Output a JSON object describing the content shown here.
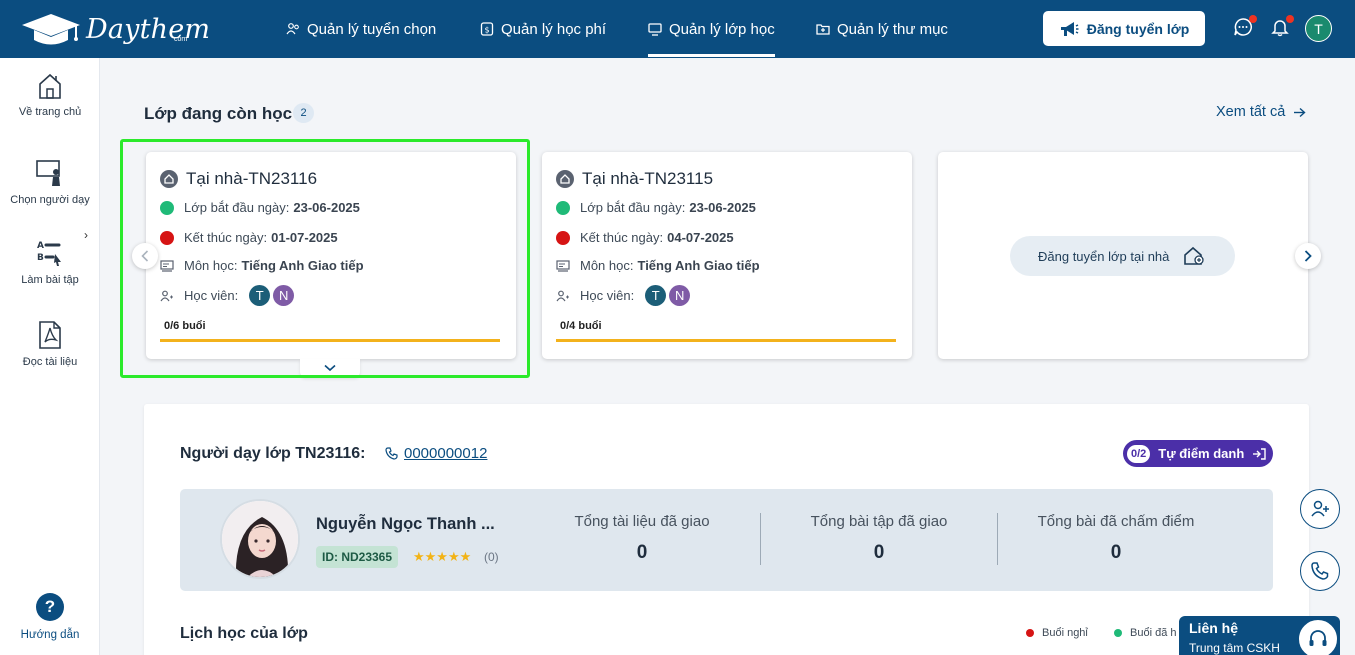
{
  "brand": {
    "name": "Daythem",
    "suffix": "com"
  },
  "nav": [
    {
      "label": "Quản lý tuyển chọn",
      "icon": "users-icon"
    },
    {
      "label": "Quản lý học phí",
      "icon": "fee-icon"
    },
    {
      "label": "Quản lý lớp học",
      "icon": "classroom-icon",
      "active": true
    },
    {
      "label": "Quản lý thư mục",
      "icon": "folder-icon"
    }
  ],
  "header": {
    "post_button": "Đăng tuyển lớp",
    "avatar_initial": "T"
  },
  "sidebar": [
    {
      "label": "Về trang chủ",
      "icon": "home-icon"
    },
    {
      "label": "Chọn người dạy",
      "icon": "teacher-icon"
    },
    {
      "label": "Làm bài tập",
      "icon": "exercise-icon"
    },
    {
      "label": "Đọc tài liệu",
      "icon": "pdf-icon"
    }
  ],
  "sidebar_help": {
    "label": "Hướng dẫn",
    "glyph": "?"
  },
  "section": {
    "title": "Lớp đang còn học",
    "count": "2",
    "see_all": "Xem tất cả"
  },
  "cards": [
    {
      "title": "Tại nhà-TN23116",
      "start_label": "Lớp bắt đầu ngày:",
      "start": "23-06-2025",
      "end_label": "Kết thúc ngày:",
      "end": "01-07-2025",
      "subject_label": "Môn học:",
      "subject": "Tiếng Anh Giao tiếp",
      "students_label": "Học viên:",
      "students": [
        "T",
        "N"
      ],
      "sessions": "0/6 buổi"
    },
    {
      "title": "Tại nhà-TN23115",
      "start_label": "Lớp bắt đầu ngày:",
      "start": "23-06-2025",
      "end_label": "Kết thúc ngày:",
      "end": "04-07-2025",
      "subject_label": "Môn học:",
      "subject": "Tiếng Anh Giao tiếp",
      "students_label": "Học viên:",
      "students": [
        "T",
        "N"
      ],
      "sessions": "0/4 buổi"
    }
  ],
  "cta": {
    "label": "Đăng tuyển lớp tại nhà"
  },
  "teacher": {
    "title": "Người dạy lớp TN23116:",
    "phone": "0000000012",
    "checkin_fraction": "0/2",
    "checkin_label": "Tự điểm danh",
    "name": "Nguyễn Ngọc Thanh ...",
    "id": "ID: ND23365",
    "stars": "★★★★★",
    "rating": "(0)",
    "stats": [
      {
        "label": "Tổng tài liệu đã giao",
        "value": "0"
      },
      {
        "label": "Tổng bài tập đã giao",
        "value": "0"
      },
      {
        "label": "Tổng bài đã chấm điểm",
        "value": "0"
      }
    ]
  },
  "schedule": {
    "title": "Lịch học của lớp",
    "legend": [
      {
        "label": "Buổi nghỉ",
        "color": "#d61414"
      },
      {
        "label": "Buổi đã h",
        "color": "#1fba78"
      }
    ]
  },
  "contact": {
    "title": "Liên hệ",
    "subtitle": "Trung tâm CSKH"
  },
  "colors": {
    "primary": "#0b4d80",
    "highlight": "#2bea2b",
    "progress": "#f3b21c",
    "checkin": "#4b2fa8"
  }
}
